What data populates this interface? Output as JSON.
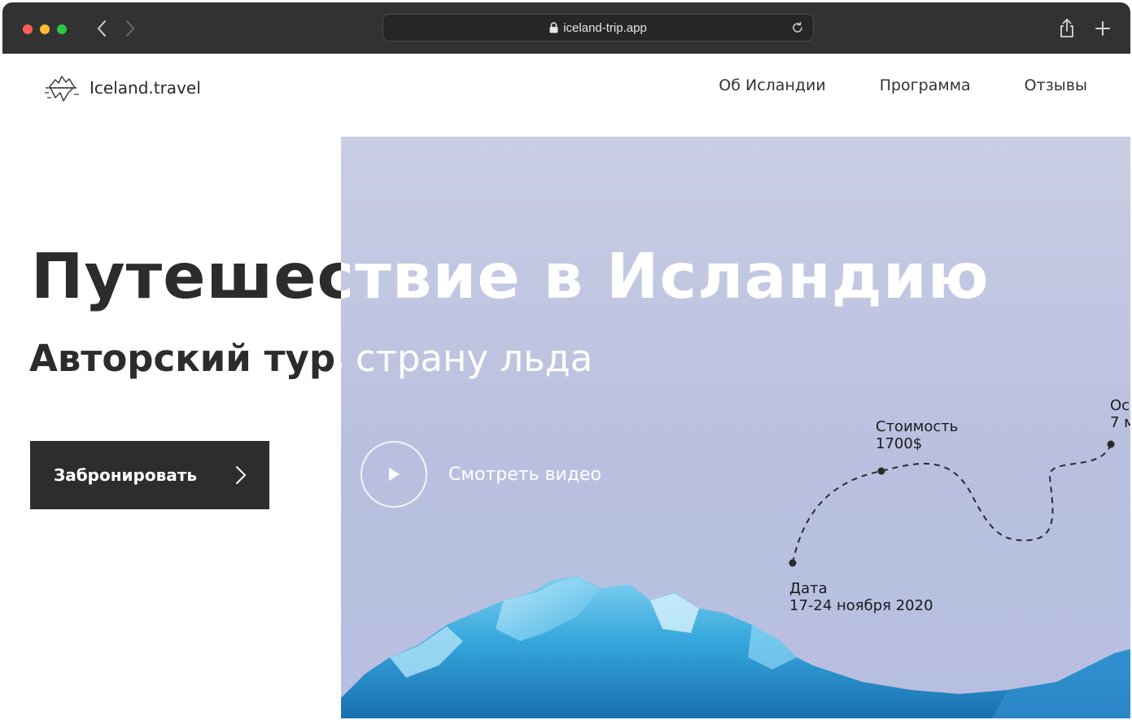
{
  "browser": {
    "url": "iceland-trip.app"
  },
  "header": {
    "logo_text": "Iceland.travel",
    "nav": [
      "Об Исландии",
      "Программа",
      "Отзывы"
    ]
  },
  "hero": {
    "title": "Путешествие в Исландию",
    "subtitle": "Авторский тур в страну льда",
    "book_button": "Забронировать",
    "video_label": "Смотреть видео"
  },
  "route_points": {
    "price": {
      "label": "Стоимость",
      "value": "1700$"
    },
    "date": {
      "label": "Дата",
      "value": "17-24 ноября 2020"
    },
    "duration": {
      "label": "Ос",
      "value": "7 м"
    }
  },
  "colors": {
    "dark": "#2d2d2d",
    "sky": "#c9cee4",
    "ice": "#4ab3e0"
  }
}
